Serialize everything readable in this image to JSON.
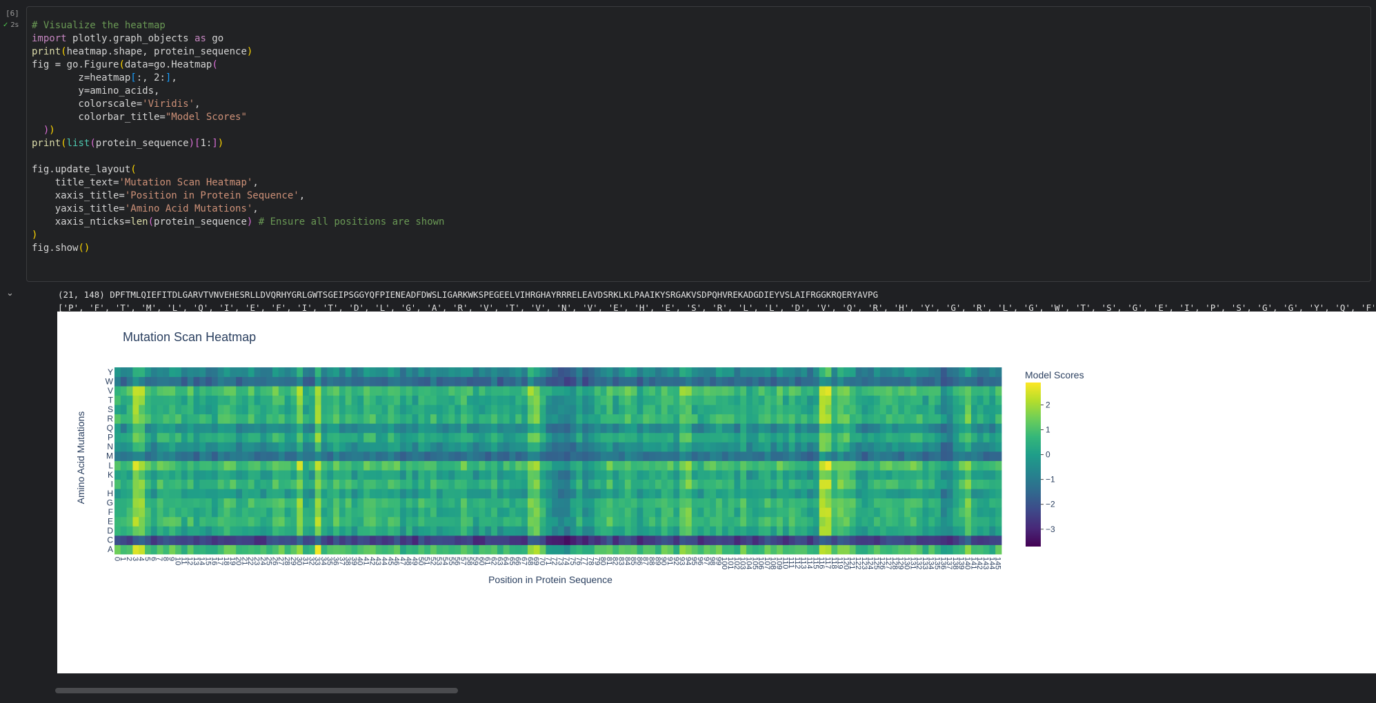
{
  "cell": {
    "exec_count": "[6]",
    "exec_time": "2s",
    "code_lines": [
      [
        [
          "# Visualize the heatmap",
          "com"
        ]
      ],
      [
        [
          "import",
          "kw"
        ],
        [
          " plotly.graph_objects ",
          "pl"
        ],
        [
          "as",
          "kw"
        ],
        [
          " go",
          "pl"
        ]
      ],
      [
        [
          "print",
          "fn"
        ],
        [
          "(",
          "p"
        ],
        [
          "heatmap.shape, protein_sequence",
          "pl"
        ],
        [
          ")",
          "p"
        ]
      ],
      [
        [
          "fig = go.Figure",
          "pl"
        ],
        [
          "(",
          "p"
        ],
        [
          "data=go.Heatmap",
          "pl"
        ],
        [
          "(",
          "p2"
        ]
      ],
      [
        [
          "        z=heatmap",
          "pl"
        ],
        [
          "[",
          "b3"
        ],
        [
          ":, 2:",
          "pl"
        ],
        [
          "]",
          "b3"
        ],
        [
          ",",
          "pl"
        ]
      ],
      [
        [
          "        y=amino_acids,",
          "pl"
        ]
      ],
      [
        [
          "        colorscale=",
          "pl"
        ],
        [
          "'Viridis'",
          "str"
        ],
        [
          ",",
          "pl"
        ]
      ],
      [
        [
          "        colorbar_title=",
          "pl"
        ],
        [
          "\"Model Scores\"",
          "str"
        ]
      ],
      [
        [
          "  ",
          "pl"
        ],
        [
          ")",
          "p2"
        ],
        [
          ")",
          "p"
        ]
      ],
      [
        [
          "print",
          "fn"
        ],
        [
          "(",
          "p"
        ],
        [
          "list",
          "cls"
        ],
        [
          "(",
          "p2"
        ],
        [
          "protein_sequence",
          "pl"
        ],
        [
          ")",
          "p2"
        ],
        [
          "[",
          "p2"
        ],
        [
          "1:",
          "pl"
        ],
        [
          "]",
          "p2"
        ],
        [
          ")",
          "p"
        ]
      ],
      [
        [
          "",
          "pl"
        ]
      ],
      [
        [
          "fig.update_layout",
          "pl"
        ],
        [
          "(",
          "p"
        ]
      ],
      [
        [
          "    title_text=",
          "pl"
        ],
        [
          "'Mutation Scan Heatmap'",
          "str"
        ],
        [
          ",",
          "pl"
        ]
      ],
      [
        [
          "    xaxis_title=",
          "pl"
        ],
        [
          "'Position in Protein Sequence'",
          "str"
        ],
        [
          ",",
          "pl"
        ]
      ],
      [
        [
          "    yaxis_title=",
          "pl"
        ],
        [
          "'Amino Acid Mutations'",
          "str"
        ],
        [
          ",",
          "pl"
        ]
      ],
      [
        [
          "    xaxis_nticks=",
          "pl"
        ],
        [
          "len",
          "fn"
        ],
        [
          "(",
          "p2"
        ],
        [
          "protein_sequence",
          "pl"
        ],
        [
          ")",
          "p2"
        ],
        [
          " # Ensure all positions are shown",
          "com"
        ]
      ],
      [
        [
          ")",
          "p"
        ]
      ],
      [
        [
          "fig.show",
          "pl"
        ],
        [
          "()",
          "p"
        ]
      ]
    ]
  },
  "output": {
    "line1": "(21, 148) DPFTMLQIEFITDLGARVTVNVEHESRLLDVQRHYGRLGWTSGEIPSGGYQFPIENEADFDWSLIGARKWKSPEGEELVIHRGHAYRRRELEAVDSRKLKLPAAIKYSRGAKVSDPQHVREKADGDIEYVSLAIFRGGKRQERYAVPG",
    "line2": "['P', 'F', 'T', 'M', 'L', 'Q', 'I', 'E', 'F', 'I', 'T', 'D', 'L', 'G', 'A', 'R', 'V', 'T', 'V', 'N', 'V', 'E', 'H', 'E', 'S', 'R', 'L', 'L', 'D', 'V', 'Q', 'R', 'H', 'Y', 'G', 'R', 'L', 'G', 'W', 'T', 'S', 'G', 'E', 'I', 'P', 'S', 'G', 'G', 'Y', 'Q', 'F', 'P', 'I', 'E', 'N', 'E', 'A', 'D', 'F', 'D', 'W', 'S', 'L', 'I', 'G', 'A', 'R', 'K', 'W', 'K', 'S', 'P', 'E', 'G', 'E', 'E', 'L', 'V', 'I', 'H', 'R', 'G', 'H', 'A', 'Y', 'R', 'R', 'R', 'E', 'L', 'E', 'A', 'V', 'D', 'S', 'R', 'K', 'L', 'K', 'L', 'P', 'A', 'A', 'I', 'K', 'Y', 'S', 'R', 'G', 'A', 'K', 'V', 'S', 'D', 'P', 'Q', 'H', 'V', 'R', 'E', 'K', 'A', 'D', 'G', 'D', 'I', 'E', 'Y', 'V', 'S', 'L', 'A', 'I', 'F', 'R', 'G', 'G', 'K', 'R', 'Q', 'E', 'R', 'Y', 'A', 'V', 'P', 'G']"
  },
  "colors": {
    "comment": "#6a9955",
    "keyword": "#c586c0",
    "plain": "#d4d4d4",
    "function": "#dcdcaa",
    "string": "#ce9178",
    "class": "#4ec9b0",
    "paren1": "#ffd700",
    "paren2": "#da70d6",
    "paren3": "#179fff"
  },
  "chart_data": {
    "type": "heatmap",
    "title": "Mutation Scan Heatmap",
    "xlabel": "Position in Protein Sequence",
    "ylabel": "Amino Acid Mutations",
    "x": {
      "start": 0,
      "end": 145
    },
    "y_categories": [
      "A",
      "C",
      "D",
      "E",
      "F",
      "G",
      "H",
      "I",
      "K",
      "L",
      "M",
      "N",
      "P",
      "Q",
      "R",
      "S",
      "T",
      "V",
      "W",
      "Y"
    ],
    "colorscale": "Viridis",
    "colorbar": {
      "title": "Model Scores",
      "ticks": [
        2,
        1,
        0,
        -1,
        -2,
        -3
      ],
      "tick_labels": [
        "2",
        "1",
        "0",
        "−1",
        "−2",
        "−3"
      ],
      "range": [
        -3.7,
        2.9
      ]
    },
    "row_bias": {
      "A": 0.9,
      "C": -2.4,
      "D": 0.2,
      "E": 0.6,
      "F": 0.5,
      "G": 0.6,
      "H": 0.0,
      "I": 0.6,
      "K": 0.1,
      "L": 0.9,
      "M": -1.2,
      "N": -0.4,
      "P": 0.3,
      "Q": -0.5,
      "R": 0.6,
      "S": 0.3,
      "T": 0.4,
      "V": 0.8,
      "W": -1.4,
      "Y": -0.6
    },
    "column_bias_notable": {
      "3": 1.4,
      "4": 1.2,
      "30": 1.2,
      "33": 1.5,
      "68": 1.0,
      "69": 0.9,
      "71": -0.6,
      "72": -1.0,
      "73": -1.0,
      "74": -1.2,
      "75": -0.8,
      "77": -0.9,
      "78": -0.7,
      "93": 0.8,
      "94": 0.8,
      "116": 1.6,
      "117": 1.5,
      "119": 0.9,
      "120": 0.8,
      "136": -1.0,
      "137": -0.9,
      "140": 0.8
    },
    "legend_position": "right"
  }
}
